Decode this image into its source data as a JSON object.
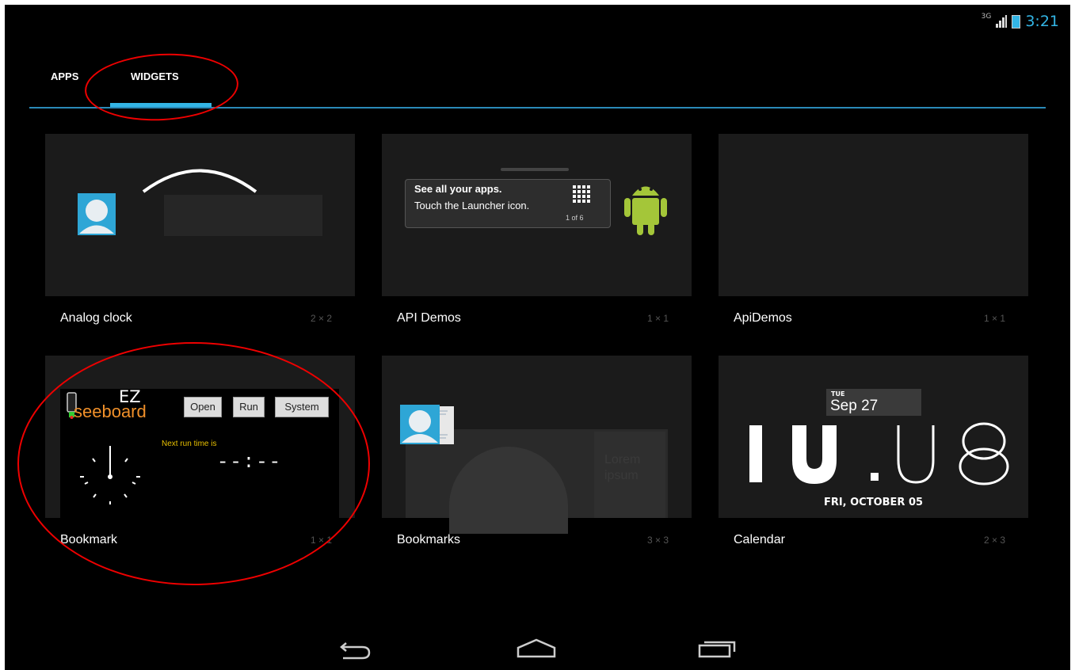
{
  "status": {
    "network": "3G",
    "time": "3:21"
  },
  "tabs": [
    {
      "label": "APPS"
    },
    {
      "label": "WIDGETS"
    }
  ],
  "widgets": [
    {
      "name": "Analog clock",
      "size": "2 × 2"
    },
    {
      "name": "API Demos",
      "size": "1 × 1"
    },
    {
      "name": "ApiDemos",
      "size": "1 × 1"
    },
    {
      "name": "Bookmark",
      "size": "1 × 1"
    },
    {
      "name": "Bookmarks",
      "size": "3 × 3"
    },
    {
      "name": "Calendar",
      "size": "2 × 3"
    }
  ],
  "previews": {
    "api_demos": {
      "line1": "See all your apps.",
      "line2": "Touch the Launcher icon.",
      "page": "1 of 6"
    },
    "bookmark": {
      "app_prefix": "EZ",
      "app_name": "seeboard",
      "buttons": [
        "Open",
        "Run",
        "System"
      ],
      "next_run": "Next run time is",
      "time_placeholder": "--:--"
    },
    "bookmarks": {
      "text": "Lorem ipsum"
    },
    "calendar": {
      "day": "TUE",
      "date": "Sep 27",
      "hours": "10",
      "minutes": "08",
      "full_date": "FRI, OCTOBER 05"
    }
  },
  "colors": {
    "accent": "#33b5e5",
    "annotation": "#e00000",
    "android_green": "#a4c639"
  },
  "nav": {
    "icons": [
      "back-icon",
      "home-icon",
      "recents-icon"
    ]
  }
}
